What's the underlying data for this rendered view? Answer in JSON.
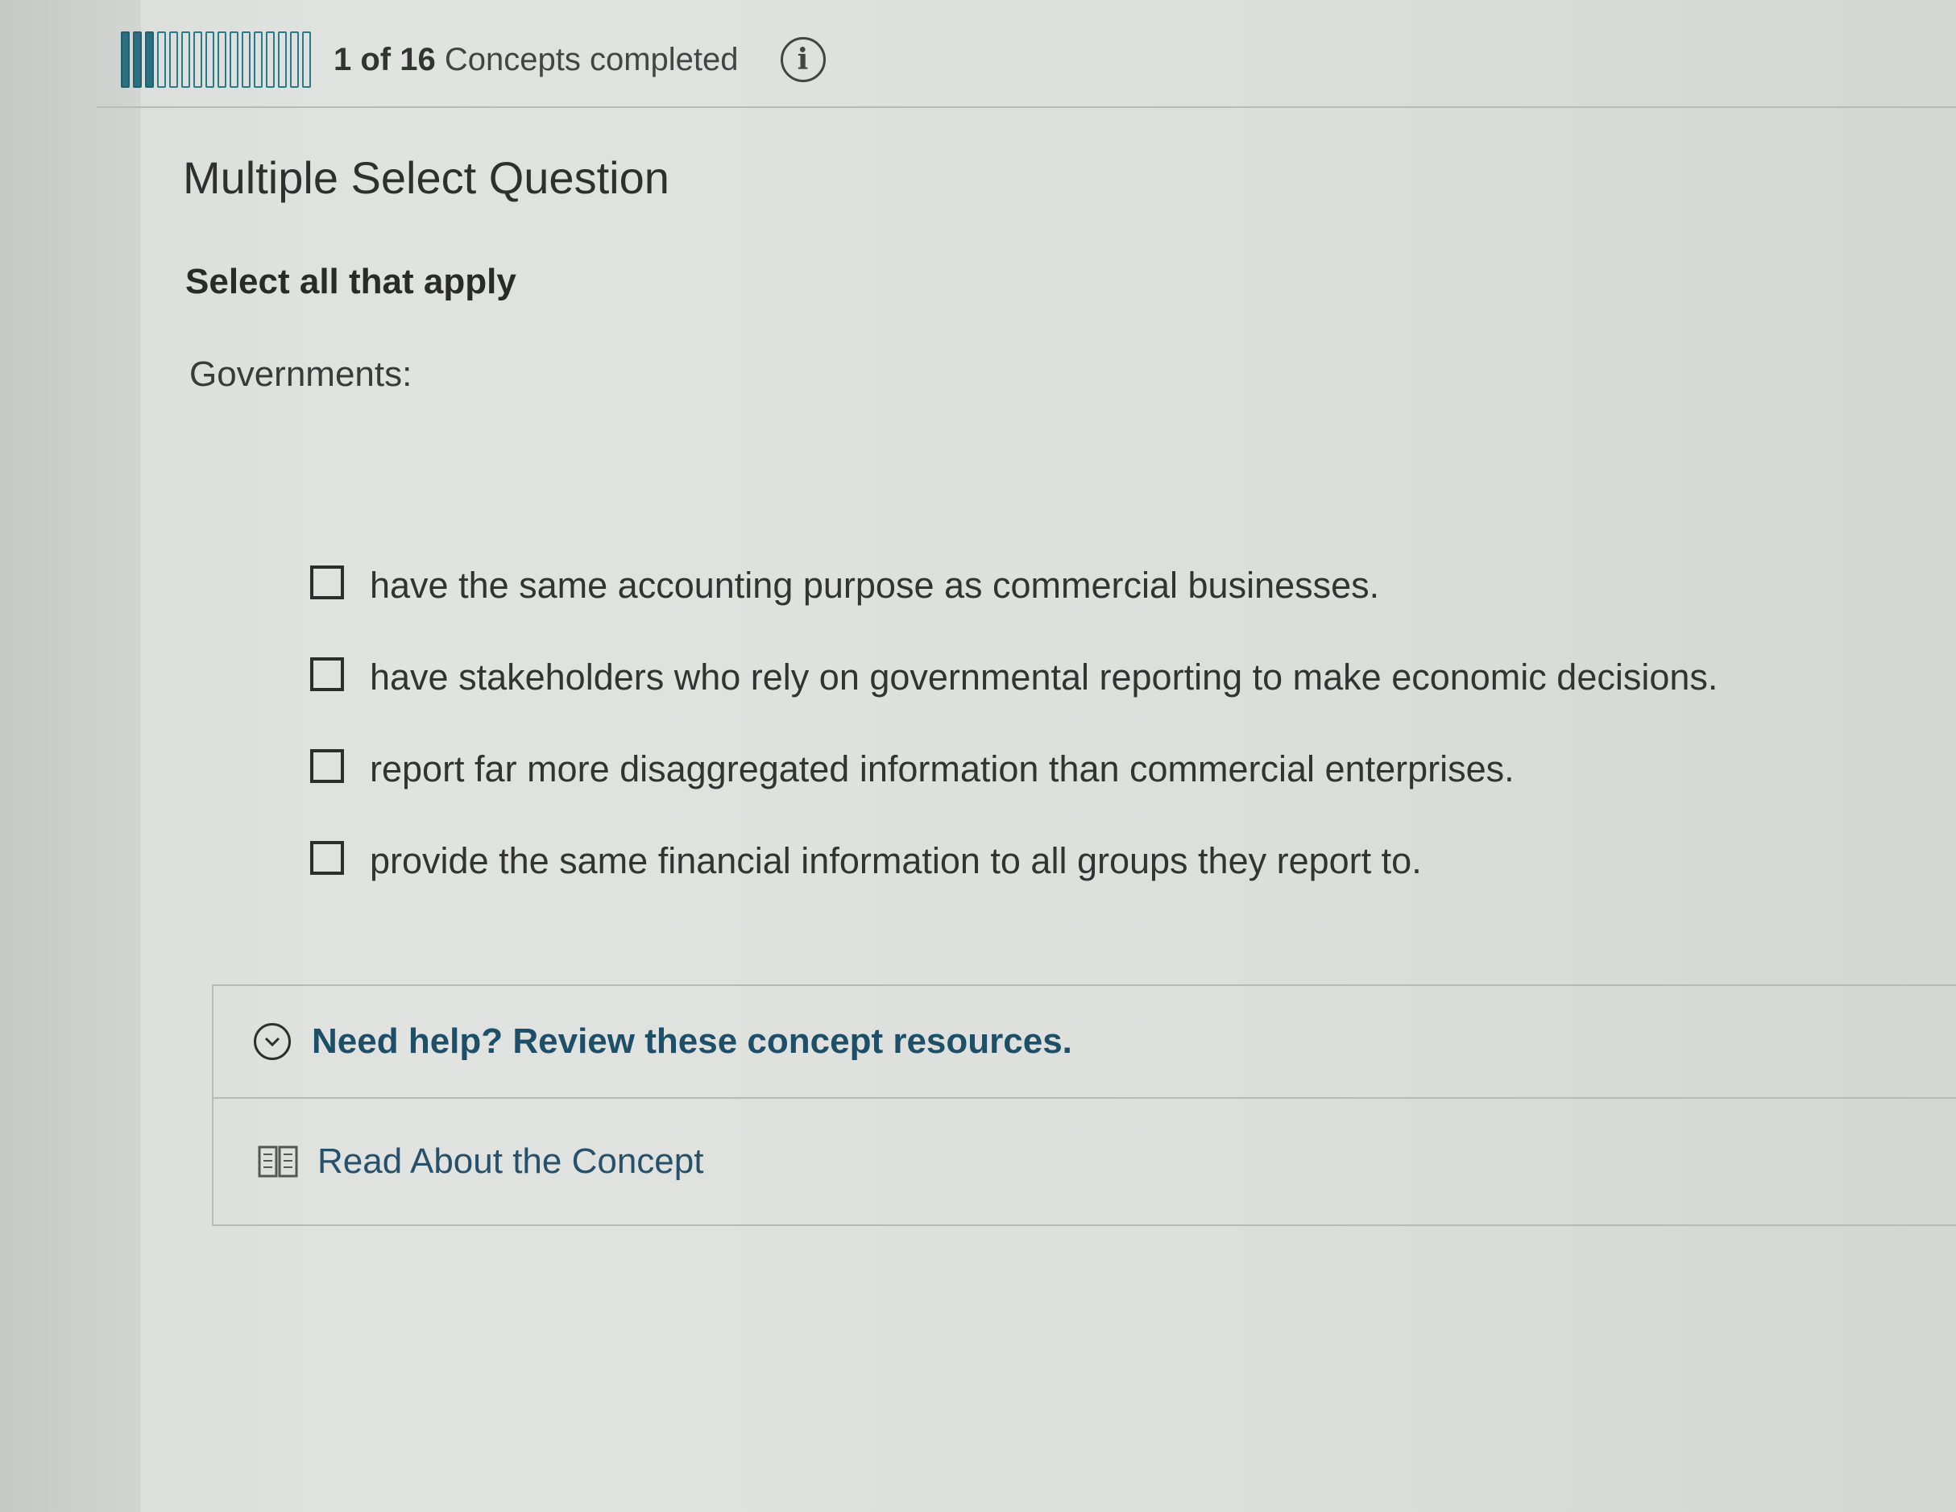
{
  "progress": {
    "completed": 1,
    "total": 16,
    "count_label": "1 of 16",
    "suffix_label": "Concepts completed",
    "fill_color": "#2b6f80"
  },
  "question": {
    "type_label": "Multiple Select Question",
    "instruction": "Select all that apply",
    "prompt": "Governments:",
    "options": [
      {
        "label": "have the same accounting purpose as commercial businesses.",
        "checked": false
      },
      {
        "label": "have stakeholders who rely on governmental reporting to make economic decisions.",
        "checked": false
      },
      {
        "label": "report far more disaggregated information than commercial enterprises.",
        "checked": false
      },
      {
        "label": "provide the same financial information to all groups they report to.",
        "checked": false
      }
    ]
  },
  "help": {
    "toggle_label": "Need help? Review these concept resources.",
    "read_label": "Read About the Concept",
    "icons": [
      "info-icon",
      "chevron-down-icon",
      "book-icon"
    ]
  }
}
